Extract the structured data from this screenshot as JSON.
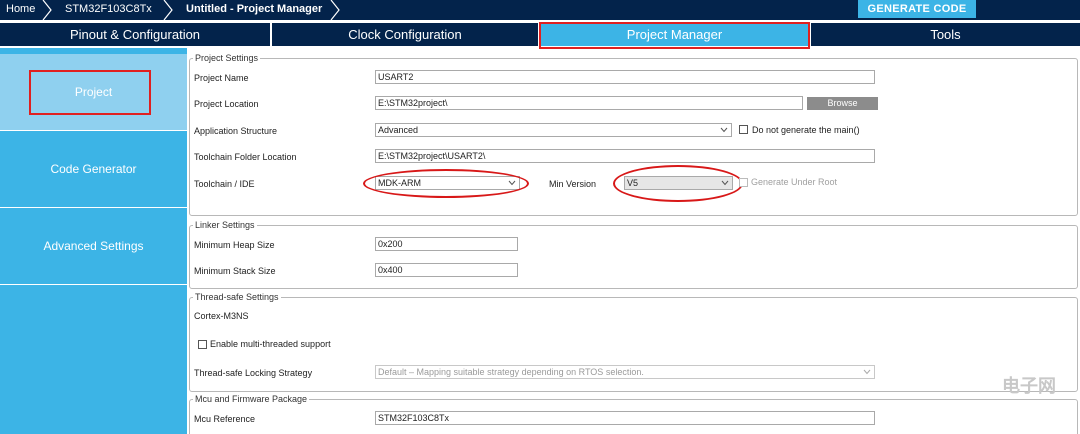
{
  "breadcrumb": {
    "home": "Home",
    "mcu": "STM32F103C8Tx",
    "project": "Untitled - Project Manager"
  },
  "toolbar": {
    "generate_code": "GENERATE CODE"
  },
  "tabs": [
    {
      "label": "Pinout & Configuration"
    },
    {
      "label": "Clock Configuration"
    },
    {
      "label": "Project Manager"
    },
    {
      "label": "Tools"
    }
  ],
  "sidebar": {
    "items": [
      {
        "label": "Project"
      },
      {
        "label": "Code Generator"
      },
      {
        "label": "Advanced Settings"
      }
    ]
  },
  "project_settings": {
    "legend": "Project Settings",
    "project_name_label": "Project Name",
    "project_name_value": "USART2",
    "project_location_label": "Project Location",
    "project_location_value": "E:\\STM32project\\",
    "browse_label": "Browse",
    "app_structure_label": "Application Structure",
    "app_structure_value": "Advanced",
    "no_main_label": "Do not generate the main()",
    "toolchain_folder_label": "Toolchain Folder Location",
    "toolchain_folder_value": "E:\\STM32project\\USART2\\",
    "toolchain_label": "Toolchain / IDE",
    "toolchain_value": "MDK-ARM",
    "min_version_label": "Min Version",
    "min_version_value": "V5",
    "generate_under_root_label": "Generate Under Root"
  },
  "linker_settings": {
    "legend": "Linker Settings",
    "heap_label": "Minimum Heap Size",
    "heap_value": "0x200",
    "stack_label": "Minimum Stack Size",
    "stack_value": "0x400"
  },
  "thread_safe": {
    "legend": "Thread-safe Settings",
    "core_label": "Cortex-M3NS",
    "multithread_label": "Enable multi-threaded support",
    "locking_label": "Thread-safe Locking Strategy",
    "locking_value": "Default – Mapping suitable strategy depending on RTOS selection."
  },
  "mcu_package": {
    "legend": "Mcu and Firmware Package",
    "mcu_ref_label": "Mcu Reference",
    "mcu_ref_value": "STM32F103C8Tx"
  },
  "watermark": {
    "text": "电子网"
  },
  "colors": {
    "navy": "#03234b",
    "accent": "#3cb4e6",
    "sidebar_active": "#8fd0ef",
    "highlight_red": "#e02020"
  },
  "icons": [
    "chevron-right-icon",
    "dropdown-caret-icon",
    "checkbox-icon"
  ]
}
